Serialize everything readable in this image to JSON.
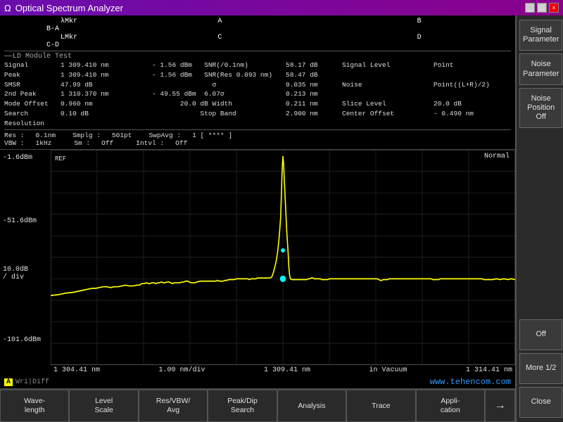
{
  "titleBar": {
    "icon": "Ω",
    "title": "Optical Spectrum Analyzer",
    "minimizeLabel": "_",
    "maximizeLabel": "□",
    "closeLabel": "×"
  },
  "markers": {
    "amkr": {
      "label": "λMkr",
      "a": "A",
      "b": "B",
      "ba": "B-A"
    },
    "lmkr": {
      "label": "LMkr",
      "c": "C",
      "d": "D",
      "cd": "C-D"
    }
  },
  "ldModuleTest": {
    "sectionLabel": "LD Module Test",
    "signal": {
      "label": "Signal",
      "value": "1 309.410 nm",
      "dbm": "- 1.56 dBm"
    },
    "snr": {
      "label": "SNR(/0.1nm)",
      "value": "58.17 dB"
    },
    "signalLevel": {
      "label": "Signal Level",
      "value": "Point"
    },
    "peak": {
      "label": "Peak",
      "value": "1 309.410 nm",
      "dbm": "- 1.56 dBm"
    },
    "snrRes": {
      "label": "SNR(Res  0.093  nm)",
      "value": "58.47 dB"
    },
    "smsr": {
      "label": "SMSR",
      "value": "47.99 dB"
    },
    "sigma": {
      "label": "σ",
      "value": "0.035 nm"
    },
    "noise": {
      "label": "Noise",
      "value": "Point((L+R)/2)"
    },
    "secondPeak": {
      "label": "2nd  Peak",
      "value": "1 310.370 nm",
      "dbm": "- 49.55 dBm",
      "sigma2": "6.07σ",
      "sigma2val": "0.213 nm"
    },
    "modeOffset": {
      "label": "Mode Offset",
      "value": "0.960 nm"
    },
    "dbWidth": {
      "label": "20.0 dB Width",
      "value": "0.211 nm"
    },
    "sliceLevel": {
      "label": "Slice Level",
      "value": "20.0 dB"
    },
    "searchRes": {
      "label": "Search Resolution",
      "value": "0.10  dB"
    },
    "stopBand": {
      "label": "Stop Band",
      "value": "2.900 nm"
    },
    "centerOffset": {
      "label": "Center Offset",
      "value": "- 0.490 nm"
    }
  },
  "settings": {
    "res": {
      "label": "Res :",
      "value": "0.1nm"
    },
    "smplg": {
      "label": "Smplg :",
      "value": "501pt"
    },
    "swpAvg": {
      "label": "SwpAvg :",
      "value": "1 [  ****  ]"
    },
    "vbw": {
      "label": "VBW :",
      "value": "1kHz"
    },
    "sm": {
      "label": "Sm :",
      "value": "Off"
    },
    "intvl": {
      "label": "Intvl :",
      "value": "Off"
    }
  },
  "graph": {
    "mode": "Normal",
    "ref": "REF",
    "yLabels": [
      "-1.6dBm",
      "-51.6dBm",
      "-101.6dBm"
    ],
    "yDiv": "10.0dB",
    "yDivLabel": "/ div",
    "xLabels": [
      "1 304.41 nm",
      "1.00 nm/div",
      "1 309.41 nm",
      "in Vacuum",
      "1 314.41 nm"
    ],
    "traceLabel": "A",
    "wriDiff": "Wri|Diff"
  },
  "watermark": "www.tehencom.com",
  "funcButtons": [
    {
      "id": "wave-length",
      "label": "Wave-\nlength"
    },
    {
      "id": "level-scale",
      "label": "Level\nScale"
    },
    {
      "id": "res-vbw-avg",
      "label": "Res/VBW/\nAvg"
    },
    {
      "id": "peak-dip-search",
      "label": "Peak/Dip\nSearch"
    },
    {
      "id": "analysis",
      "label": "Analysis"
    },
    {
      "id": "trace",
      "label": "Trace"
    },
    {
      "id": "application",
      "label": "Appli-\ncation"
    },
    {
      "id": "arrow-right",
      "label": "→"
    }
  ],
  "sideButtons": [
    {
      "id": "signal-parameter",
      "label": "Signal\nParameter"
    },
    {
      "id": "noise-parameter",
      "label": "Noise\nParameter"
    },
    {
      "id": "noise-position-off",
      "label": "Noise\nPosition\nOff"
    },
    {
      "id": "off",
      "label": "Off"
    },
    {
      "id": "more-1-2",
      "label": "More 1/2"
    },
    {
      "id": "close",
      "label": "Close"
    }
  ]
}
